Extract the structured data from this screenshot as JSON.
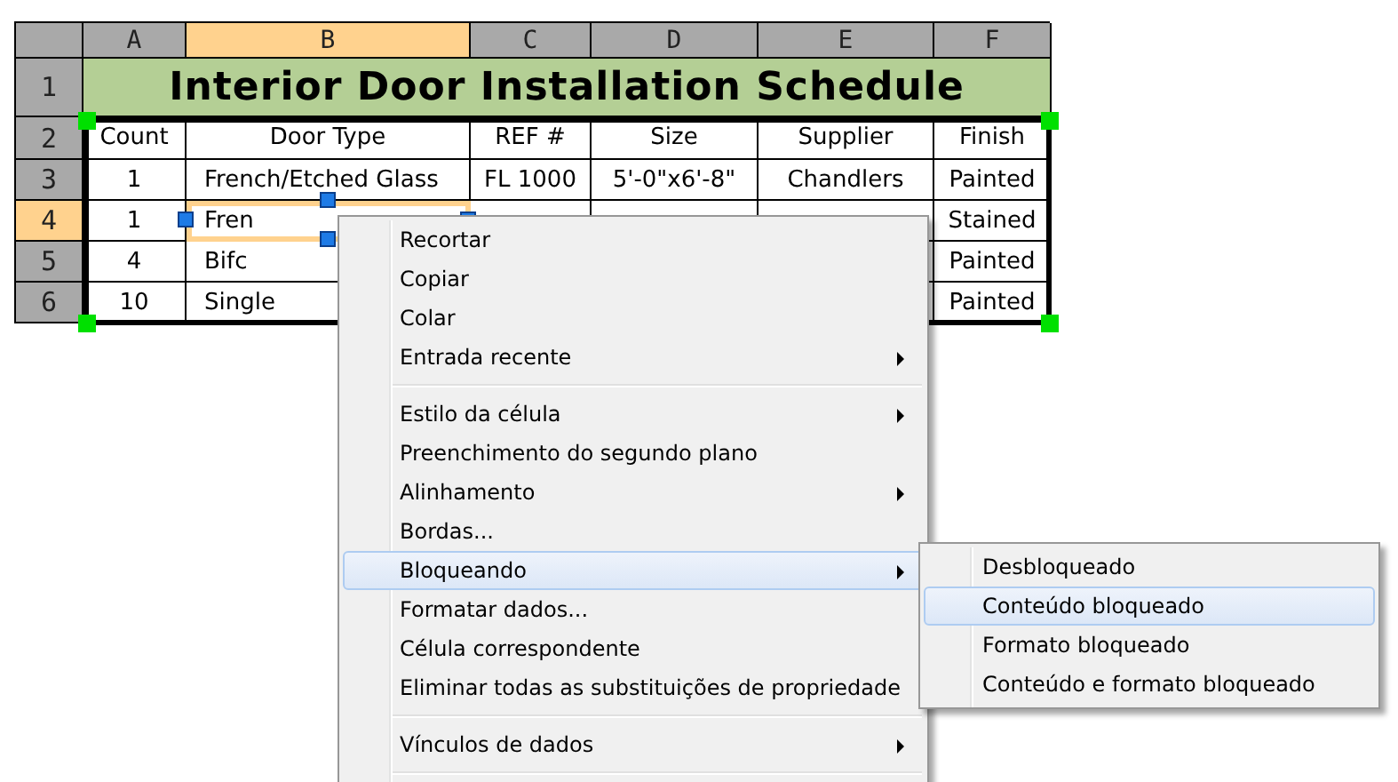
{
  "sheet": {
    "columns": [
      {
        "label": "A",
        "selected": false
      },
      {
        "label": "B",
        "selected": true
      },
      {
        "label": "C",
        "selected": false
      },
      {
        "label": "D",
        "selected": false
      },
      {
        "label": "E",
        "selected": false
      },
      {
        "label": "F",
        "selected": false
      }
    ],
    "rows": [
      {
        "label": "1",
        "selected": false,
        "kind": "title",
        "title": "Interior Door Installation Schedule"
      },
      {
        "label": "2",
        "selected": false,
        "kind": "data",
        "cells": [
          {
            "text": "Count",
            "selected": false
          },
          {
            "text": "Door Type",
            "selected": false
          },
          {
            "text": "REF #",
            "selected": false
          },
          {
            "text": "Size",
            "selected": false
          },
          {
            "text": "Supplier",
            "selected": false
          },
          {
            "text": "Finish",
            "selected": false
          }
        ]
      },
      {
        "label": "3",
        "selected": false,
        "kind": "data",
        "cells": [
          {
            "text": "1",
            "selected": false
          },
          {
            "text": "French/Etched Glass",
            "selected": false
          },
          {
            "text": "FL 1000",
            "selected": false
          },
          {
            "text": "5'-0\"x6'-8\"",
            "selected": false
          },
          {
            "text": "Chandlers",
            "selected": false
          },
          {
            "text": "Painted",
            "selected": false
          }
        ]
      },
      {
        "label": "4",
        "selected": true,
        "kind": "data",
        "cells": [
          {
            "text": "1",
            "selected": false
          },
          {
            "text": "Fren",
            "selected": true
          },
          null,
          null,
          null,
          {
            "text": "Stained",
            "selected": false
          }
        ]
      },
      {
        "label": "5",
        "selected": false,
        "kind": "data",
        "cells": [
          {
            "text": "4",
            "selected": false
          },
          {
            "text": "Bifc",
            "selected": false
          },
          null,
          null,
          null,
          {
            "text": "Painted",
            "selected": false
          }
        ]
      },
      {
        "label": "6",
        "selected": false,
        "kind": "data",
        "cells": [
          {
            "text": "10",
            "selected": false
          },
          {
            "text": "Single",
            "selected": false
          },
          null,
          null,
          null,
          {
            "text": "Painted",
            "selected": false
          }
        ]
      }
    ]
  },
  "context_menu": {
    "items": [
      {
        "kind": "item",
        "label": "Recortar",
        "has_submenu": false,
        "selected": false
      },
      {
        "kind": "item",
        "label": "Copiar",
        "has_submenu": false,
        "selected": false
      },
      {
        "kind": "item",
        "label": "Colar",
        "has_submenu": false,
        "selected": false
      },
      {
        "kind": "item",
        "label": "Entrada recente",
        "has_submenu": true,
        "selected": false
      },
      {
        "kind": "separator"
      },
      {
        "kind": "item",
        "label": "Estilo da célula",
        "has_submenu": true,
        "selected": false
      },
      {
        "kind": "item",
        "label": "Preenchimento do segundo plano",
        "has_submenu": false,
        "selected": false
      },
      {
        "kind": "item",
        "label": "Alinhamento",
        "has_submenu": true,
        "selected": false
      },
      {
        "kind": "item",
        "label": "Bordas...",
        "has_submenu": false,
        "selected": false
      },
      {
        "kind": "item",
        "label": "Bloqueando",
        "has_submenu": true,
        "selected": true
      },
      {
        "kind": "item",
        "label": "Formatar dados...",
        "has_submenu": false,
        "selected": false
      },
      {
        "kind": "item",
        "label": "Célula correspondente",
        "has_submenu": false,
        "selected": false
      },
      {
        "kind": "item",
        "label": "Eliminar todas as substituições de propriedade",
        "has_submenu": false,
        "selected": false
      },
      {
        "kind": "separator"
      },
      {
        "kind": "item",
        "label": "Vínculos de dados",
        "has_submenu": true,
        "selected": false
      },
      {
        "kind": "separator"
      }
    ]
  },
  "submenu": {
    "items": [
      {
        "label": "Desbloqueado",
        "selected": false
      },
      {
        "label": "Conteúdo bloqueado",
        "selected": true
      },
      {
        "label": "Formato bloqueado",
        "selected": false
      },
      {
        "label": "Conteúdo e formato bloqueado",
        "selected": false
      }
    ]
  }
}
